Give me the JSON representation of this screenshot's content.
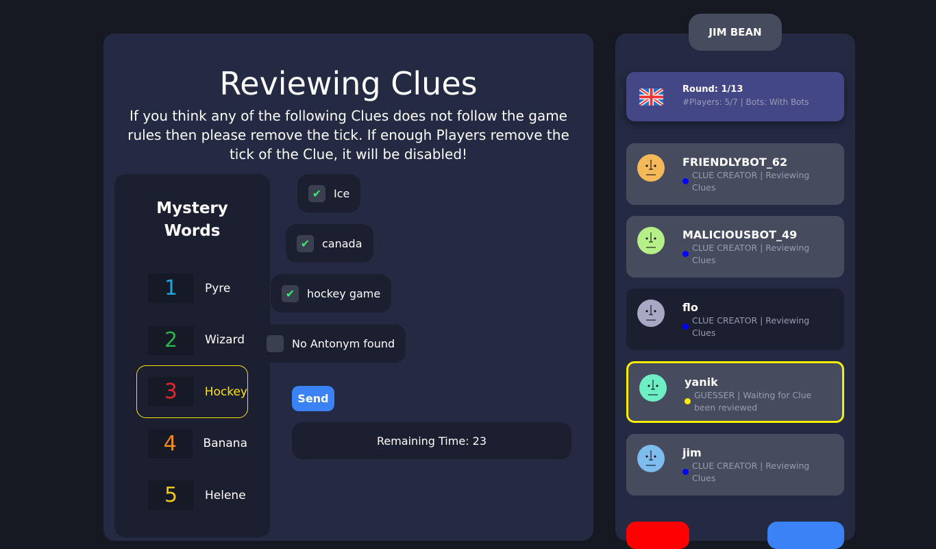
{
  "header": {
    "username": "JIM BEAN"
  },
  "main": {
    "title": "Reviewing Clues",
    "description": "If you think any of the following Clues does not follow the game rules then please remove the tick. If enough Players remove the tick of the Clue, it will be disabled!",
    "mystery_title": "Mystery Words",
    "words": [
      {
        "num": "1",
        "word": "Pyre",
        "color": "#1ea7e1"
      },
      {
        "num": "2",
        "word": "Wizard",
        "color": "#2bb34a"
      },
      {
        "num": "3",
        "word": "Hockey",
        "color": "#e8252a"
      },
      {
        "num": "4",
        "word": "Banana",
        "color": "#f28a1c"
      },
      {
        "num": "5",
        "word": "Helene",
        "color": "#f5c518"
      }
    ],
    "clues": [
      {
        "text": "Ice",
        "checked": true
      },
      {
        "text": "canada",
        "checked": true
      },
      {
        "text": "hockey game",
        "checked": true
      },
      {
        "text": "No Antonym found",
        "checked": false
      }
    ],
    "send_label": "Send",
    "remaining_time": "Remaining Time: 23"
  },
  "sidebar": {
    "round": "Round: 1/13",
    "info": "#Players: 5/7 | Bots: With Bots",
    "players": [
      {
        "name": "FRIENDLYBOT_62",
        "status": "CLUE CREATOR | Reviewing Clues",
        "avatar_color": "#f5b95a",
        "dot": "#0000ff"
      },
      {
        "name": "MALICIOUSBOT_49",
        "status": "CLUE CREATOR | Reviewing Clues",
        "avatar_color": "#b6ee88",
        "dot": "#0000ff"
      },
      {
        "name": "flo",
        "status": "CLUE CREATOR | Reviewing Clues",
        "avatar_color": "#a6a8c4",
        "dot": "#0000ff"
      },
      {
        "name": "yanik",
        "status": "GUESSER | Waiting for Clue been reviewed",
        "avatar_color": "#6eeec5",
        "dot": "#ffee00"
      },
      {
        "name": "jim",
        "status": "CLUE CREATOR | Reviewing Clues",
        "avatar_color": "#7fbcee",
        "dot": "#0000ff"
      }
    ]
  }
}
